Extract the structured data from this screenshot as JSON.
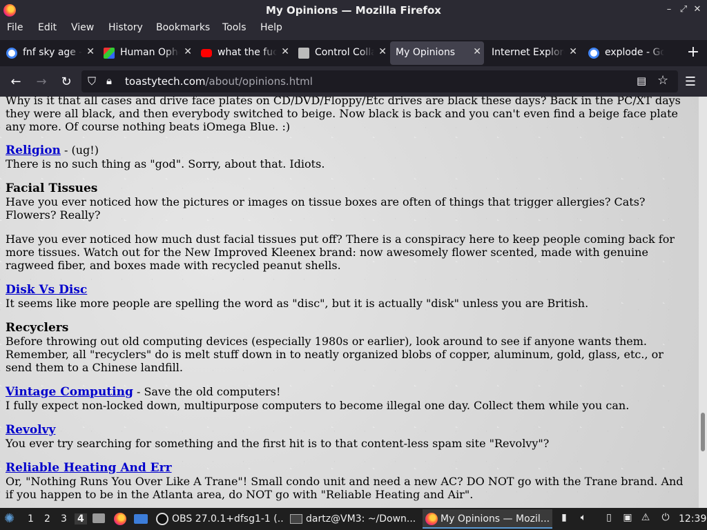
{
  "window": {
    "title": "My Opinions — Mozilla Firefox"
  },
  "menu": [
    "File",
    "Edit",
    "View",
    "History",
    "Bookmarks",
    "Tools",
    "Help"
  ],
  "tabs": [
    {
      "label": "fnf sky age - Google Search",
      "icon": "google-icon",
      "active": false
    },
    {
      "label": "Human Ophelia",
      "icon": "site-icon",
      "active": false
    },
    {
      "label": "what the fuck",
      "icon": "youtube-icon",
      "active": false
    },
    {
      "label": "Control Collapse",
      "icon": "site-icon",
      "active": false
    },
    {
      "label": "My Opinions",
      "icon": "",
      "active": true
    },
    {
      "label": "Internet Explorer",
      "icon": "",
      "active": false
    },
    {
      "label": "explode - Google Search",
      "icon": "google-icon",
      "active": false
    }
  ],
  "urlbar": {
    "domain": "toastytech.com",
    "path": "/about/opinions.html"
  },
  "content": {
    "intro_text": "Why is it that all cases and drive face plates on CD/DVD/Floppy/Etc drives are black these days? Back in the PC/XT days they were all black, and then everybody switched to beige. Now black is back and you can't even find a beige face plate any more. Of course nothing beats iOmega Blue. :)",
    "religion_link": "Religion",
    "religion_suffix": " - (ug!)",
    "religion_text": "There is no such thing as \"god\". Sorry, about that. Idiots.",
    "tissues_heading": "Facial Tissues",
    "tissues_text1": "Have you ever noticed how the pictures or images on tissue boxes are often of things that trigger allergies? Cats? Flowers? Really?",
    "tissues_text2": "Have you ever noticed how much dust facial tissues put off? There is a conspiracy here to keep people coming back for more tissues. Watch out for the New Improved Kleenex brand: now awesomely flower scented, made with genuine ragweed fiber, and boxes made with recycled peanut shells.",
    "disk_link": "Disk Vs Disc",
    "disk_text": "It seems like more people are spelling the word as \"disc\", but it is actually \"disk\" unless you are British.",
    "recyclers_heading": "Recyclers",
    "recyclers_text": "Before throwing out old computing devices (especially 1980s or earlier), look around to see if anyone wants them. Remember, all \"recyclers\" do is melt stuff down in to neatly organized blobs of copper, aluminum, gold, glass, etc., or send them to a Chinese landfill.",
    "vintage_link": "Vintage Computing",
    "vintage_suffix": " - Save the old computers!",
    "vintage_text": "I fully expect non-locked down, multipurpose computers to become illegal one day. Collect them while you can.",
    "revolvy_link": "Revolvy",
    "revolvy_text": "You ever try searching for something and the first hit is to that content-less spam site \"Revolvy\"?",
    "heating_link": "Reliable Heating And Err",
    "heating_text": "Or, \"Nothing Runs You Over Like A Trane\"! Small condo unit and need a new AC? DO NOT go with the Trane brand. And if you happen to be in the Atlanta area, do NOT go with \"Reliable Heating and Air\"."
  },
  "taskbar": {
    "workspaces": [
      "1",
      "2",
      "3",
      "4"
    ],
    "active_workspace": "4",
    "tasks": [
      {
        "label": "OBS 27.0.1+dfsg1-1 (...",
        "icon": "obs-icon"
      },
      {
        "label": "dartz@VM3: ~/Down...",
        "icon": "terminal-icon"
      },
      {
        "label": "My Opinions — Mozil...",
        "icon": "firefox-icon"
      }
    ],
    "clock": "12:39"
  },
  "colors": {
    "link": "#0000cc",
    "chrome_dark": "#2b2a33",
    "tab_strip": "#1c1b22"
  }
}
